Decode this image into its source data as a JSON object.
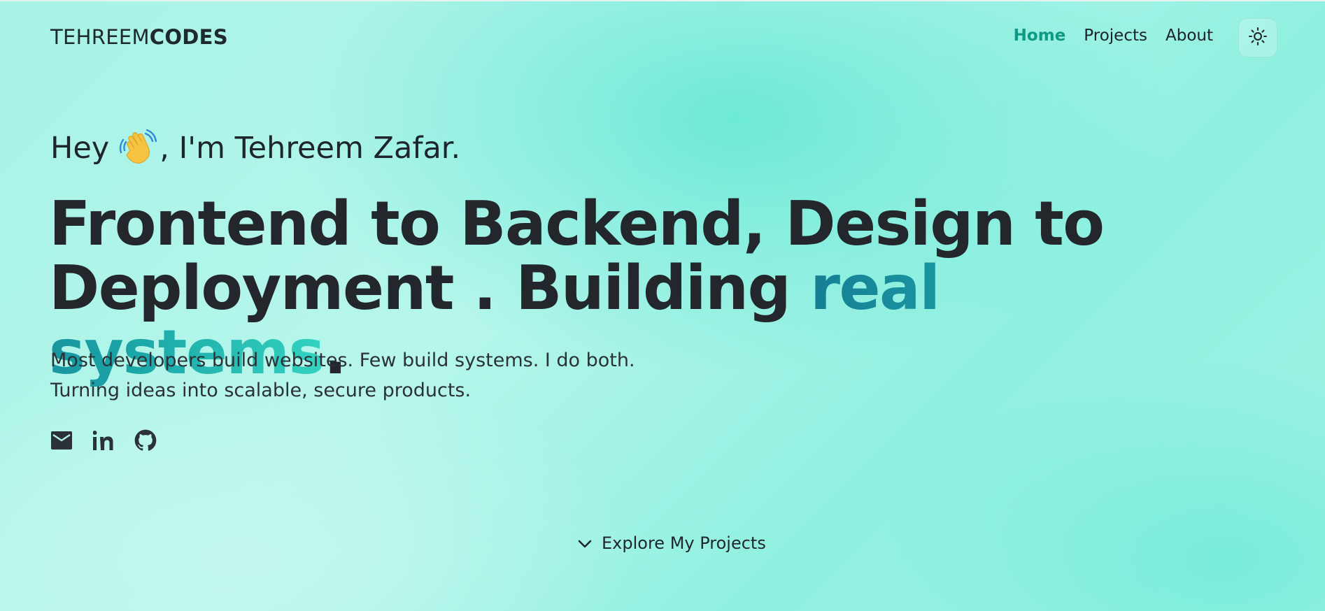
{
  "header": {
    "brand_light": "TEHREEM",
    "brand_bold": "CODES",
    "nav": [
      {
        "label": "Home",
        "active": true
      },
      {
        "label": "Projects",
        "active": false
      },
      {
        "label": "About",
        "active": false
      }
    ],
    "theme_toggle_icon": "sun-icon"
  },
  "hero": {
    "greeting_before": "Hey ",
    "greeting_emoji": "waving-hand-icon",
    "greeting_after": ", I'm Tehreem Zafar.",
    "headline_main": "Frontend to Backend, Design to Deployment . Building ",
    "headline_accent": "real systems",
    "headline_end": ".",
    "sub_line_1": "Most developers build websites. Few build systems. I do both.",
    "sub_line_2": "Turning ideas into scalable, secure products.",
    "socials": [
      "mail-icon",
      "linkedin-icon",
      "github-icon"
    ],
    "explore_label": "Explore My Projects"
  },
  "colors": {
    "accent": "#0e9a84",
    "gradient_start": "#167e95",
    "gradient_end": "#33d3c0",
    "text": "#23272b"
  }
}
